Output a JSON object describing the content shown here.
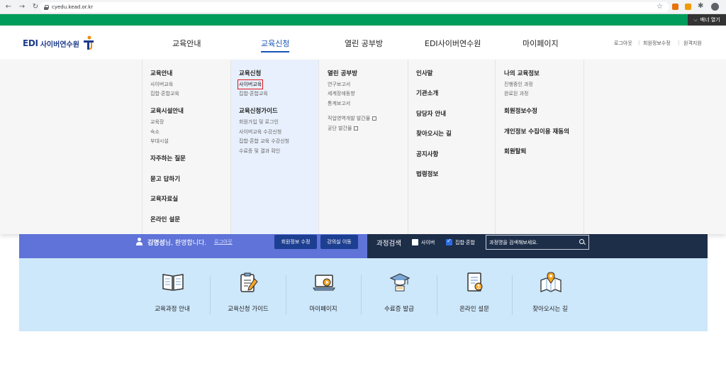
{
  "browser": {
    "url": "cyedu.kead.or.kr"
  },
  "green_bar": {
    "banner_label": "배너 열기"
  },
  "header": {
    "logo_edi": "EDI",
    "logo_name": "사이버연수원",
    "gnb": [
      "교육안내",
      "교육신청",
      "열린 공부방",
      "EDI사이버연수원",
      "마이페이지"
    ],
    "active_gnb": "교육신청",
    "util": [
      "로그아웃",
      "회원정보수정",
      "원격지원"
    ]
  },
  "mega_menu": {
    "col1": {
      "h1": "교육안내",
      "s1": [
        "사이버교육",
        "집합·혼합교육"
      ],
      "h2": "교육시설안내",
      "s2": [
        "교육장",
        "숙소",
        "부대시설"
      ],
      "h3": "자주하는 질문",
      "h4": "묻고 답하기",
      "h5": "교육자료실",
      "h6": "온라인 설문"
    },
    "col2": {
      "h1": "교육신청",
      "s1": [
        "사이버교육",
        "집합·혼합교육"
      ],
      "h2": "교육신청가이드",
      "s2": [
        "회원가입 및 로그인",
        "사이버교육 수강신청",
        "집합·혼합 교육 수강신청",
        "수료증 및 결과 확인"
      ]
    },
    "col3": {
      "h1": "열린 공부방",
      "s1": [
        "연구보고서",
        "세계장애동향",
        "통계보고서",
        "직업영역개발 발간물",
        "공단 발간물"
      ]
    },
    "col4": {
      "items": [
        "인사말",
        "기관소개",
        "담당자 안내",
        "찾아오시는 길",
        "공지사항",
        "법령정보"
      ]
    },
    "col5": {
      "h1": "나의 교육정보",
      "s1": [
        "진행중인 과정",
        "완료된 과정"
      ],
      "items": [
        "회원정보수정",
        "개인정보 수집이용 재동의",
        "회원탈퇴"
      ]
    }
  },
  "welcome": {
    "name": "김명성",
    "greeting": "님, 환영합니다.",
    "logout": "로그아웃",
    "btn_edit": "회원정보 수정",
    "btn_room": "강의실 이동"
  },
  "course_search": {
    "title": "과정검색",
    "cb_cyber": "사이버",
    "cb_cyber_checked": false,
    "cb_mixed": "집합·혼합",
    "cb_mixed_checked": true,
    "placeholder": "과정명을 검색해보세요."
  },
  "quick_links": [
    {
      "label": "교육과정 안내",
      "icon": "book-icon"
    },
    {
      "label": "교육신청 가이드",
      "icon": "clipboard-pencil-icon"
    },
    {
      "label": "마이페이지",
      "icon": "laptop-play-icon"
    },
    {
      "label": "수료증 발급",
      "icon": "graduation-cap-icon"
    },
    {
      "label": "온라인 설문",
      "icon": "survey-document-icon"
    },
    {
      "label": "찾아오시는 길",
      "icon": "map-pin-icon"
    }
  ],
  "colors": {
    "green_bar": "#009c5b",
    "brand_blue": "#1a55b5",
    "welcome_band": "#5f73d8",
    "search_band": "#1d2e49",
    "quick_bg": "#cde7fb",
    "highlight_box": "#e0141e"
  }
}
